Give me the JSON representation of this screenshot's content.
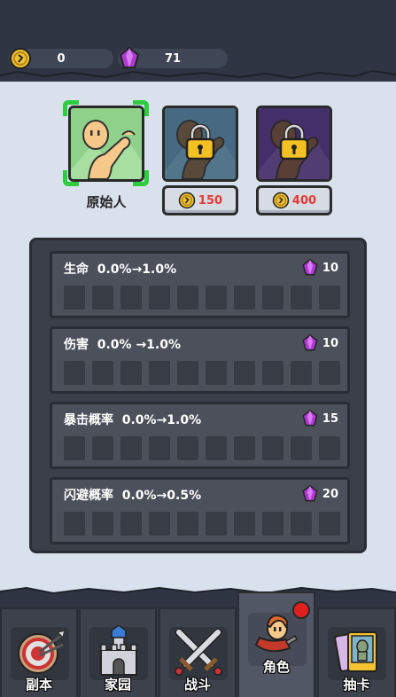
{
  "currency": {
    "coins": "0",
    "gems": "71"
  },
  "characters": [
    {
      "name": "原始人",
      "selected": true,
      "locked": false
    },
    {
      "price": "150",
      "locked": true
    },
    {
      "price": "400",
      "locked": true
    }
  ],
  "stats": [
    {
      "label": "生命  0.0%→1.0%",
      "cost": "10"
    },
    {
      "label": "伤害  0.0% →1.0%",
      "cost": "10"
    },
    {
      "label": "暴击概率  0.0%→1.0%",
      "cost": "15"
    },
    {
      "label": "闪避概率  0.0%→0.5%",
      "cost": "20"
    }
  ],
  "nav": {
    "tabs": [
      {
        "label": "副本",
        "icon": "target-icon"
      },
      {
        "label": "家园",
        "icon": "castle-icon"
      },
      {
        "label": "战斗",
        "icon": "crossed-swords-icon"
      },
      {
        "label": "角色",
        "icon": "character-icon",
        "active": true
      },
      {
        "label": "抽卡",
        "icon": "card-icon"
      }
    ]
  },
  "colors": {
    "selected_border": "#2ecc40",
    "price_text": "#e53935",
    "panel": "#3a3f4a",
    "notify": "#e21e1e"
  }
}
